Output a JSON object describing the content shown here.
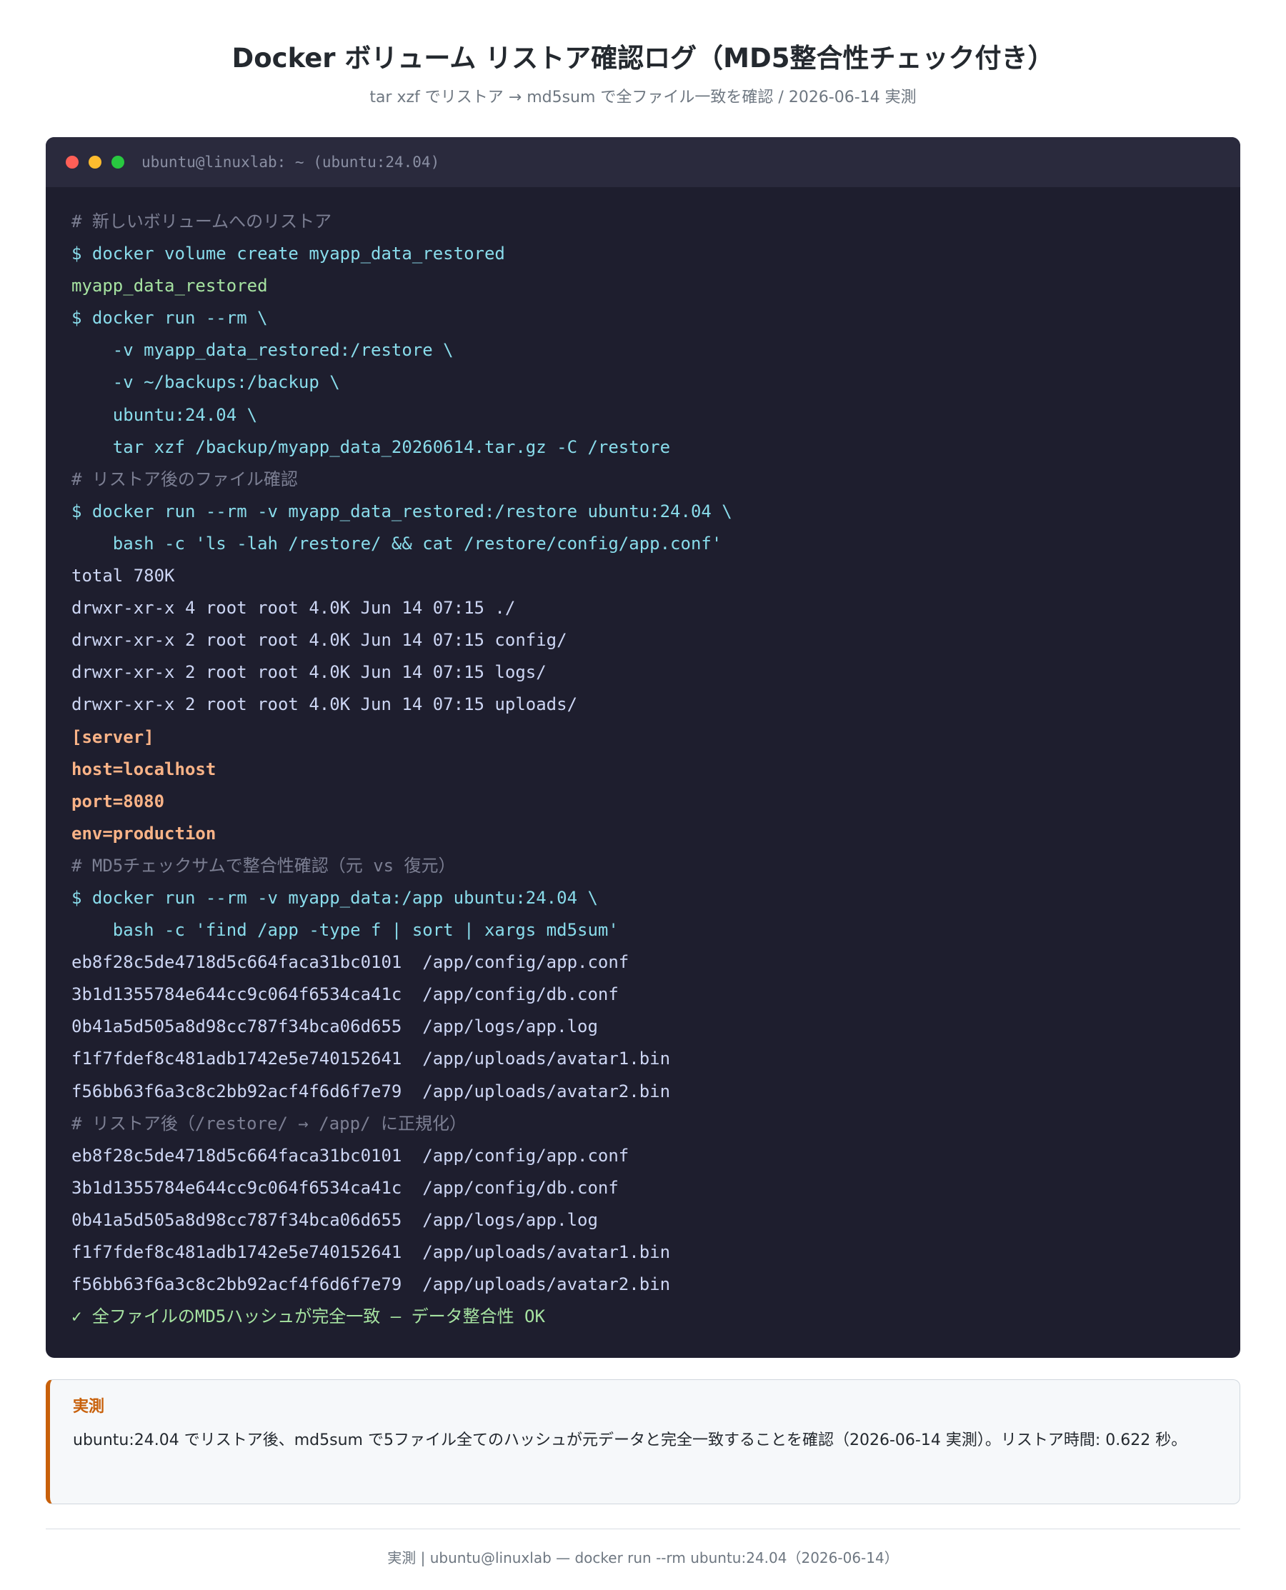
{
  "header": {
    "title": "Docker ボリューム リストア確認ログ（MD5整合性チェック付き）",
    "subtitle": "tar xzf でリストア → md5sum で全ファイル一致を確認 / 2026-06-14 実測"
  },
  "terminal": {
    "window_title": "ubuntu@linuxlab: ~ (ubuntu:24.04)",
    "lines": [
      {
        "type": "comment",
        "text": "# 新しいボリュームへのリストア"
      },
      {
        "type": "cmd",
        "text": "$ docker volume create myapp_data_restored"
      },
      {
        "type": "ok",
        "text": "myapp_data_restored"
      },
      {
        "type": "cmd",
        "text": "$ docker run --rm \\"
      },
      {
        "type": "cmd",
        "text": "    -v myapp_data_restored:/restore \\"
      },
      {
        "type": "cmd",
        "text": "    -v ~/backups:/backup \\"
      },
      {
        "type": "cmd",
        "text": "    ubuntu:24.04 \\"
      },
      {
        "type": "cmd",
        "text": "    tar xzf /backup/myapp_data_20260614.tar.gz -C /restore"
      },
      {
        "type": "comment",
        "text": "# リストア後のファイル確認"
      },
      {
        "type": "cmd",
        "text": "$ docker run --rm -v myapp_data_restored:/restore ubuntu:24.04 \\"
      },
      {
        "type": "cmd",
        "text": "    bash -c 'ls -lah /restore/ && cat /restore/config/app.conf'"
      },
      {
        "type": "out",
        "text": "total 780K"
      },
      {
        "type": "out",
        "text": "drwxr-xr-x 4 root root 4.0K Jun 14 07:15 ./"
      },
      {
        "type": "out",
        "text": "drwxr-xr-x 2 root root 4.0K Jun 14 07:15 config/"
      },
      {
        "type": "out",
        "text": "drwxr-xr-x 2 root root 4.0K Jun 14 07:15 logs/"
      },
      {
        "type": "out",
        "text": "drwxr-xr-x 2 root root 4.0K Jun 14 07:15 uploads/"
      },
      {
        "type": "cfg",
        "text": "[server]"
      },
      {
        "type": "cfg",
        "text": "host=localhost"
      },
      {
        "type": "cfg",
        "text": "port=8080"
      },
      {
        "type": "cfg",
        "text": "env=production"
      },
      {
        "type": "comment",
        "text": "# MD5チェックサムで整合性確認（元 vs 復元）"
      },
      {
        "type": "cmd",
        "text": "$ docker run --rm -v myapp_data:/app ubuntu:24.04 \\"
      },
      {
        "type": "cmd",
        "text": "    bash -c 'find /app -type f | sort | xargs md5sum'"
      },
      {
        "type": "out",
        "text": "eb8f28c5de4718d5c664faca31bc0101  /app/config/app.conf"
      },
      {
        "type": "out",
        "text": "3b1d1355784e644cc9c064f6534ca41c  /app/config/db.conf"
      },
      {
        "type": "out",
        "text": "0b41a5d505a8d98cc787f34bca06d655  /app/logs/app.log"
      },
      {
        "type": "out",
        "text": "f1f7fdef8c481adb1742e5e740152641  /app/uploads/avatar1.bin"
      },
      {
        "type": "out",
        "text": "f56bb63f6a3c8c2bb92acf4f6d6f7e79  /app/uploads/avatar2.bin"
      },
      {
        "type": "comment",
        "text": "# リストア後（/restore/ → /app/ に正規化）"
      },
      {
        "type": "out",
        "text": "eb8f28c5de4718d5c664faca31bc0101  /app/config/app.conf"
      },
      {
        "type": "out",
        "text": "3b1d1355784e644cc9c064f6534ca41c  /app/config/db.conf"
      },
      {
        "type": "out",
        "text": "0b41a5d505a8d98cc787f34bca06d655  /app/logs/app.log"
      },
      {
        "type": "out",
        "text": "f1f7fdef8c481adb1742e5e740152641  /app/uploads/avatar1.bin"
      },
      {
        "type": "out",
        "text": "f56bb63f6a3c8c2bb92acf4f6d6f7e79  /app/uploads/avatar2.bin"
      },
      {
        "type": "ok",
        "text": "✓ 全ファイルのMD5ハッシュが完全一致 — データ整合性 OK"
      }
    ]
  },
  "note": {
    "heading": "実測",
    "text": "ubuntu:24.04 でリストア後、md5sum で5ファイル全てのハッシュが元データと完全一致することを確認（2026-06-14 実測）。リストア時間: 0.622 秒。"
  },
  "footer": {
    "text": "実測 | ubuntu@linuxlab — docker run --rm ubuntu:24.04（2026-06-14）"
  },
  "colors": {
    "terminal_bg": "#1e1e2e",
    "terminal_bar": "#2a2a3d",
    "comment": "#7c7f93",
    "command": "#89dceb",
    "success": "#a6e3a1",
    "output": "#cdd6f4",
    "config": "#fab387",
    "accent": "#c8600a"
  }
}
